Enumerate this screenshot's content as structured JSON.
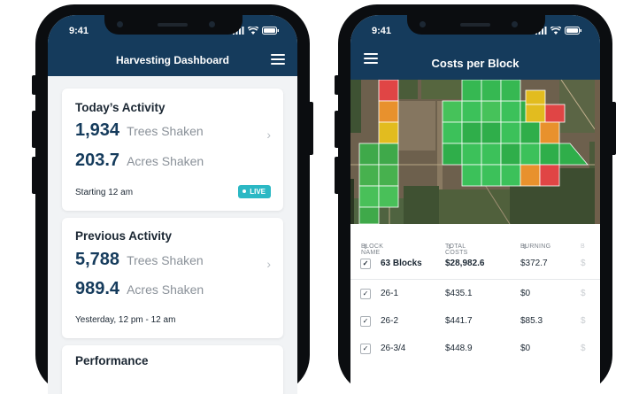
{
  "left_phone": {
    "status_time": "9:41",
    "header_title": "Harvesting Dashboard",
    "cards": {
      "today": {
        "title": "Today’s Activity",
        "trees_value": "1,934",
        "trees_label": "Trees Shaken",
        "acres_value": "203.7",
        "acres_label": "Acres Shaken",
        "footer": "Starting 12 am",
        "badge": "LIVE"
      },
      "previous": {
        "title": "Previous Activity",
        "trees_value": "5,788",
        "trees_label": "Trees Shaken",
        "acres_value": "989.4",
        "acres_label": "Acres Shaken",
        "footer": "Yesterday, 12 pm - 12 am"
      },
      "performance": {
        "title": "Performance"
      }
    }
  },
  "right_phone": {
    "status_time": "9:41",
    "header_title": "Costs per Block",
    "table": {
      "columns": [
        "BLOCK NAME",
        "TOTAL COSTS",
        "BURNING"
      ],
      "summary": {
        "name": "63 Blocks",
        "total": "$28,982.6",
        "burning": "$372.7"
      },
      "rows": [
        {
          "name": "26-1",
          "total": "$435.1",
          "burning": "$0"
        },
        {
          "name": "26-2",
          "total": "$441.7",
          "burning": "$85.3"
        },
        {
          "name": "26-3/4",
          "total": "$448.9",
          "burning": "$0"
        }
      ]
    }
  },
  "colors": {
    "header_navy": "#153b5c",
    "live_teal": "#2bb8c4",
    "cost_low": "#3cc15a",
    "cost_mid": "#e2bc1f",
    "cost_high": "#e64848"
  }
}
